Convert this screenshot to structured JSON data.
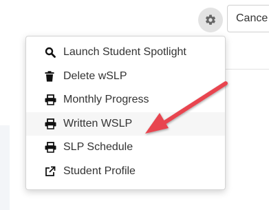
{
  "header": {
    "settings_icon": "gear-icon",
    "cancel_label": "Cance"
  },
  "menu": {
    "items": [
      {
        "label": "Launch Student Spotlight",
        "icon": "search-icon"
      },
      {
        "label": "Delete wSLP",
        "icon": "trash-icon"
      },
      {
        "label": "Monthly Progress",
        "icon": "print-icon"
      },
      {
        "label": "Written WSLP",
        "icon": "print-icon",
        "highlighted": true
      },
      {
        "label": "SLP Schedule",
        "icon": "print-icon"
      },
      {
        "label": "Student Profile",
        "icon": "external-link-icon"
      }
    ]
  },
  "annotation": {
    "arrow_color": "#e84550",
    "points_to": "Written WSLP"
  },
  "colors": {
    "gear_button_bg": "#e3e3e3",
    "gear_icon": "#666666",
    "menu_highlight": "#f6f6f6"
  }
}
